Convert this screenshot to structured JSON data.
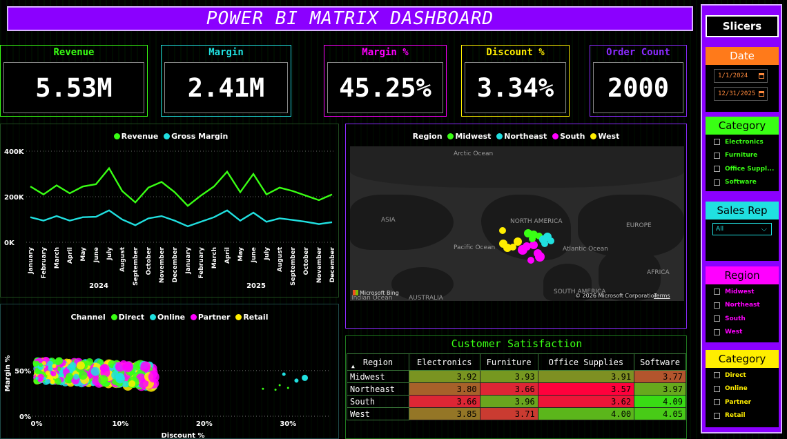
{
  "title": "POWER BI MATRIX DASHBOARD",
  "kpis": [
    {
      "label": "Revenue",
      "value": "5.53M",
      "color": "#39ff14"
    },
    {
      "label": "Margin",
      "value": "2.41M",
      "color": "#20e0e0"
    },
    {
      "label": "Margin %",
      "value": "45.25%",
      "color": "#ff00ff"
    },
    {
      "label": "Discount %",
      "value": "3.34%",
      "color": "#ffee00"
    },
    {
      "label": "Order Count",
      "value": "2000",
      "color": "#8b2bff"
    }
  ],
  "slicers": {
    "title": "Slicers",
    "date": {
      "label": "Date",
      "start": "1/1/2024",
      "end": "12/31/2025",
      "calendar_icon": "calendar-icon"
    },
    "category": {
      "label": "Category",
      "items": [
        "Electronics",
        "Furniture",
        "Office Suppl...",
        "Software"
      ]
    },
    "sales_rep": {
      "label": "Sales Rep",
      "selected": "All"
    },
    "region": {
      "label": "Region",
      "items": [
        "Midwest",
        "Northeast",
        "South",
        "West"
      ]
    },
    "channel": {
      "label": "Category",
      "items": [
        "Direct",
        "Online",
        "Partner",
        "Retail"
      ]
    }
  },
  "colors": {
    "green": "#39ff14",
    "cyan": "#20e0e0",
    "magenta": "#ff00ff",
    "yellow": "#ffee00",
    "purple": "#8b00ff",
    "orange": "#ff7a1a"
  },
  "line_chart": {
    "legend": [
      "Revenue",
      "Gross Margin"
    ],
    "y_ticks": [
      "400K",
      "200K",
      "0K"
    ],
    "years": [
      "2024",
      "2025"
    ]
  },
  "map": {
    "legend_title": "Region",
    "legend": [
      "Midwest",
      "Northeast",
      "South",
      "West"
    ],
    "labels": {
      "arctic": "Arctic Ocean",
      "asia": "ASIA",
      "na": "NORTH AMERICA",
      "europe": "EUROPE",
      "pacific": "Pacific Ocean",
      "atlantic": "Atlantic Ocean",
      "africa": "AFRICA",
      "sa": "SOUTH AMERICA",
      "australia": "AUSTRALIA",
      "indian": "Indian Ocean",
      "bing": "Microsoft Bing",
      "copyright": "© 2026 Microsoft Corporation",
      "terms": "Terms"
    }
  },
  "scatter": {
    "legend_title": "Channel",
    "legend": [
      "Direct",
      "Online",
      "Partner",
      "Retail"
    ]
  },
  "matrix": {
    "title": "Customer Satisfaction",
    "row_header": "Region",
    "sort_icon": "sort-ascending-icon",
    "columns": [
      "Electronics",
      "Furniture",
      "Office Supplies",
      "Software"
    ],
    "rows": [
      {
        "label": "Midwest",
        "values": [
          "3.92",
          "3.93",
          "3.91",
          "3.77"
        ]
      },
      {
        "label": "Northeast",
        "values": [
          "3.80",
          "3.66",
          "3.57",
          "3.97"
        ]
      },
      {
        "label": "South",
        "values": [
          "3.66",
          "3.96",
          "3.62",
          "4.09"
        ]
      },
      {
        "label": "West",
        "values": [
          "3.85",
          "3.71",
          "4.00",
          "4.05"
        ]
      }
    ]
  },
  "chart_data": [
    {
      "type": "line",
      "x": [
        "January",
        "February",
        "March",
        "April",
        "May",
        "June",
        "July",
        "August",
        "September",
        "October",
        "November",
        "December",
        "January",
        "February",
        "March",
        "April",
        "May",
        "June",
        "July",
        "August",
        "September",
        "October",
        "November",
        "December"
      ],
      "series": [
        {
          "name": "Revenue",
          "values": [
            245000,
            210000,
            250000,
            215000,
            245000,
            255000,
            325000,
            225000,
            175000,
            240000,
            265000,
            220000,
            160000,
            205000,
            245000,
            310000,
            220000,
            300000,
            210000,
            240000,
            225000,
            205000,
            185000,
            210000
          ]
        },
        {
          "name": "Gross Margin",
          "values": [
            110000,
            95000,
            115000,
            95000,
            110000,
            112000,
            140000,
            100000,
            75000,
            105000,
            115000,
            95000,
            70000,
            90000,
            110000,
            140000,
            95000,
            130000,
            90000,
            105000,
            98000,
            90000,
            80000,
            88000
          ]
        }
      ],
      "ylim": [
        0,
        400000
      ],
      "grid": true,
      "legend": "top"
    },
    {
      "type": "scatter",
      "xlabel": "Discount %",
      "ylabel": "Margin %",
      "x_ticks": [
        "0%",
        "10%",
        "20%",
        "30%"
      ],
      "y_ticks": [
        "50%",
        "0%"
      ],
      "xlim": [
        0,
        35
      ],
      "ylim": [
        0,
        65
      ],
      "legend": "top"
    }
  ]
}
